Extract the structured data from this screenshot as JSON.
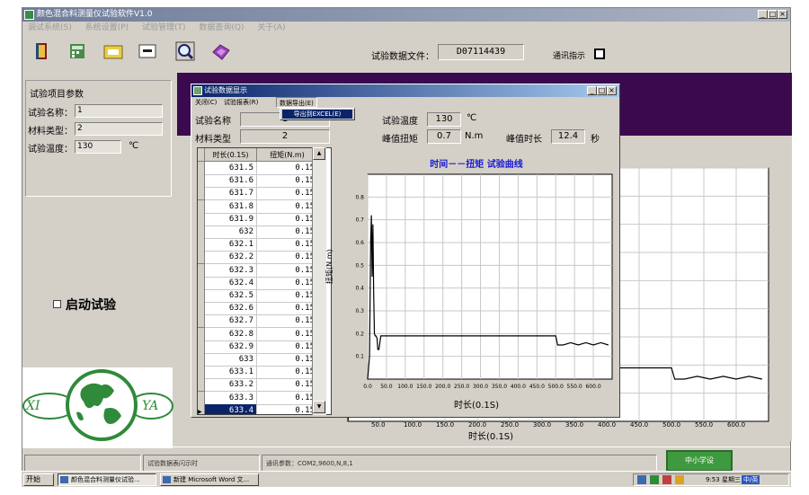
{
  "main_window": {
    "title": "颜色混合料测量仪试验软件V1.0",
    "menu": [
      "调试系统(S)",
      "系统设置(P)",
      "试验管理(T)",
      "数据查询(Q)",
      "关于(A)"
    ],
    "toolbar_icons": [
      "book-icon",
      "calculator-icon",
      "settings-card-icon",
      "data-card-icon",
      "magnifier-icon",
      "disk-icon"
    ],
    "data_file_label": "试验数据文件：",
    "data_file_value": "D07114439",
    "comm_label": "通讯指示",
    "params": {
      "title": "试验项目参数",
      "name_label": "试验名称：",
      "name_value": "1",
      "material_label": "材料类型：",
      "material_value": "2",
      "temp_label": "试验温度：",
      "temp_value": "130",
      "temp_unit": "℃"
    },
    "start_label": "启动试验",
    "logo": {
      "left_text": "XI",
      "right_text": "YA"
    },
    "status": {
      "cell1": "试验数据表闪示时",
      "cell2": "通讯参数：COM2,9600,N,8,1",
      "green_button": "中小学设"
    },
    "bg_chart": {
      "xlabel": "时长(0.1S)",
      "xticks": [
        "50.0",
        "100.0",
        "150.0",
        "200.0",
        "250.0",
        "300.0",
        "350.0",
        "400.0",
        "450.0",
        "500.0",
        "550.0",
        "600.0"
      ]
    }
  },
  "taskbar": {
    "start": "开始",
    "items": [
      "颜色混合料测量仪试验...",
      "新建 Microsoft Word 文..."
    ],
    "time": "9:53 星期三",
    "ime": "中/英"
  },
  "dialog": {
    "title": "试验数据显示",
    "menu": [
      "关闭(C)",
      "试验报表(R)",
      "数据导出(E)"
    ],
    "dropdown_item": "导出到EXCEL(E)",
    "name_label": "试验名称",
    "name_value": "1",
    "material_label": "材料类型",
    "material_value": "2",
    "temp_label": "试验温度",
    "temp_value": "130",
    "temp_unit": "℃",
    "peak_torque_label": "峰值扭矩",
    "peak_torque_value": "0.7",
    "peak_torque_unit": "N.m",
    "peak_time_label": "峰值时长",
    "peak_time_value": "12.4",
    "peak_time_unit": "秒",
    "table": {
      "headers": [
        "时长(0.1S)",
        "扭矩(N.m)"
      ],
      "rows": [
        [
          "631.5",
          "0.15"
        ],
        [
          "631.6",
          "0.15"
        ],
        [
          "631.7",
          "0.15"
        ],
        [
          "631.8",
          "0.15"
        ],
        [
          "631.9",
          "0.15"
        ],
        [
          "632",
          "0.15"
        ],
        [
          "632.1",
          "0.15"
        ],
        [
          "632.2",
          "0.15"
        ],
        [
          "632.3",
          "0.15"
        ],
        [
          "632.4",
          "0.15"
        ],
        [
          "632.5",
          "0.15"
        ],
        [
          "632.6",
          "0.15"
        ],
        [
          "632.7",
          "0.15"
        ],
        [
          "632.8",
          "0.15"
        ],
        [
          "632.9",
          "0.15"
        ],
        [
          "633",
          "0.15"
        ],
        [
          "633.1",
          "0.15"
        ],
        [
          "633.2",
          "0.15"
        ],
        [
          "633.3",
          "0.15"
        ],
        [
          "633.4",
          "0.15"
        ]
      ]
    },
    "chart": {
      "title": "时间－－扭矩  试验曲线",
      "xlabel": "时长(0.1S)",
      "ylabel": "扭矩(N.m)"
    }
  },
  "chart_data": {
    "type": "line",
    "title": "时间－－扭矩  试验曲线",
    "xlabel": "时长(0.1S)",
    "ylabel": "扭矩(N.m)",
    "xlim": [
      0,
      650
    ],
    "ylim": [
      0,
      0.9
    ],
    "xticks": [
      "0.0",
      "50.0",
      "100.0",
      "150.0",
      "200.0",
      "250.0",
      "300.0",
      "350.0",
      "400.0",
      "450.0",
      "500.0",
      "550.0",
      "600.0"
    ],
    "yticks": [
      "0.1",
      "0.2",
      "0.3",
      "0.4",
      "0.5",
      "0.6",
      "0.7",
      "0.8"
    ],
    "grid": true,
    "series": [
      {
        "x": [
          0,
          5,
          8,
          10,
          12,
          14,
          16,
          18,
          20,
          22,
          25,
          27,
          30,
          35,
          40,
          50,
          60,
          100,
          150,
          200,
          250,
          300,
          350,
          400,
          450,
          500,
          505,
          510,
          520,
          540,
          560,
          580,
          600,
          620,
          640
        ],
        "y": [
          0,
          0.1,
          0.6,
          0.72,
          0.45,
          0.68,
          0.38,
          0.2,
          0.19,
          0.19,
          0.18,
          0.13,
          0.13,
          0.19,
          0.19,
          0.19,
          0.19,
          0.19,
          0.19,
          0.19,
          0.19,
          0.19,
          0.19,
          0.19,
          0.19,
          0.19,
          0.15,
          0.15,
          0.15,
          0.16,
          0.15,
          0.16,
          0.15,
          0.16,
          0.15
        ]
      }
    ]
  }
}
